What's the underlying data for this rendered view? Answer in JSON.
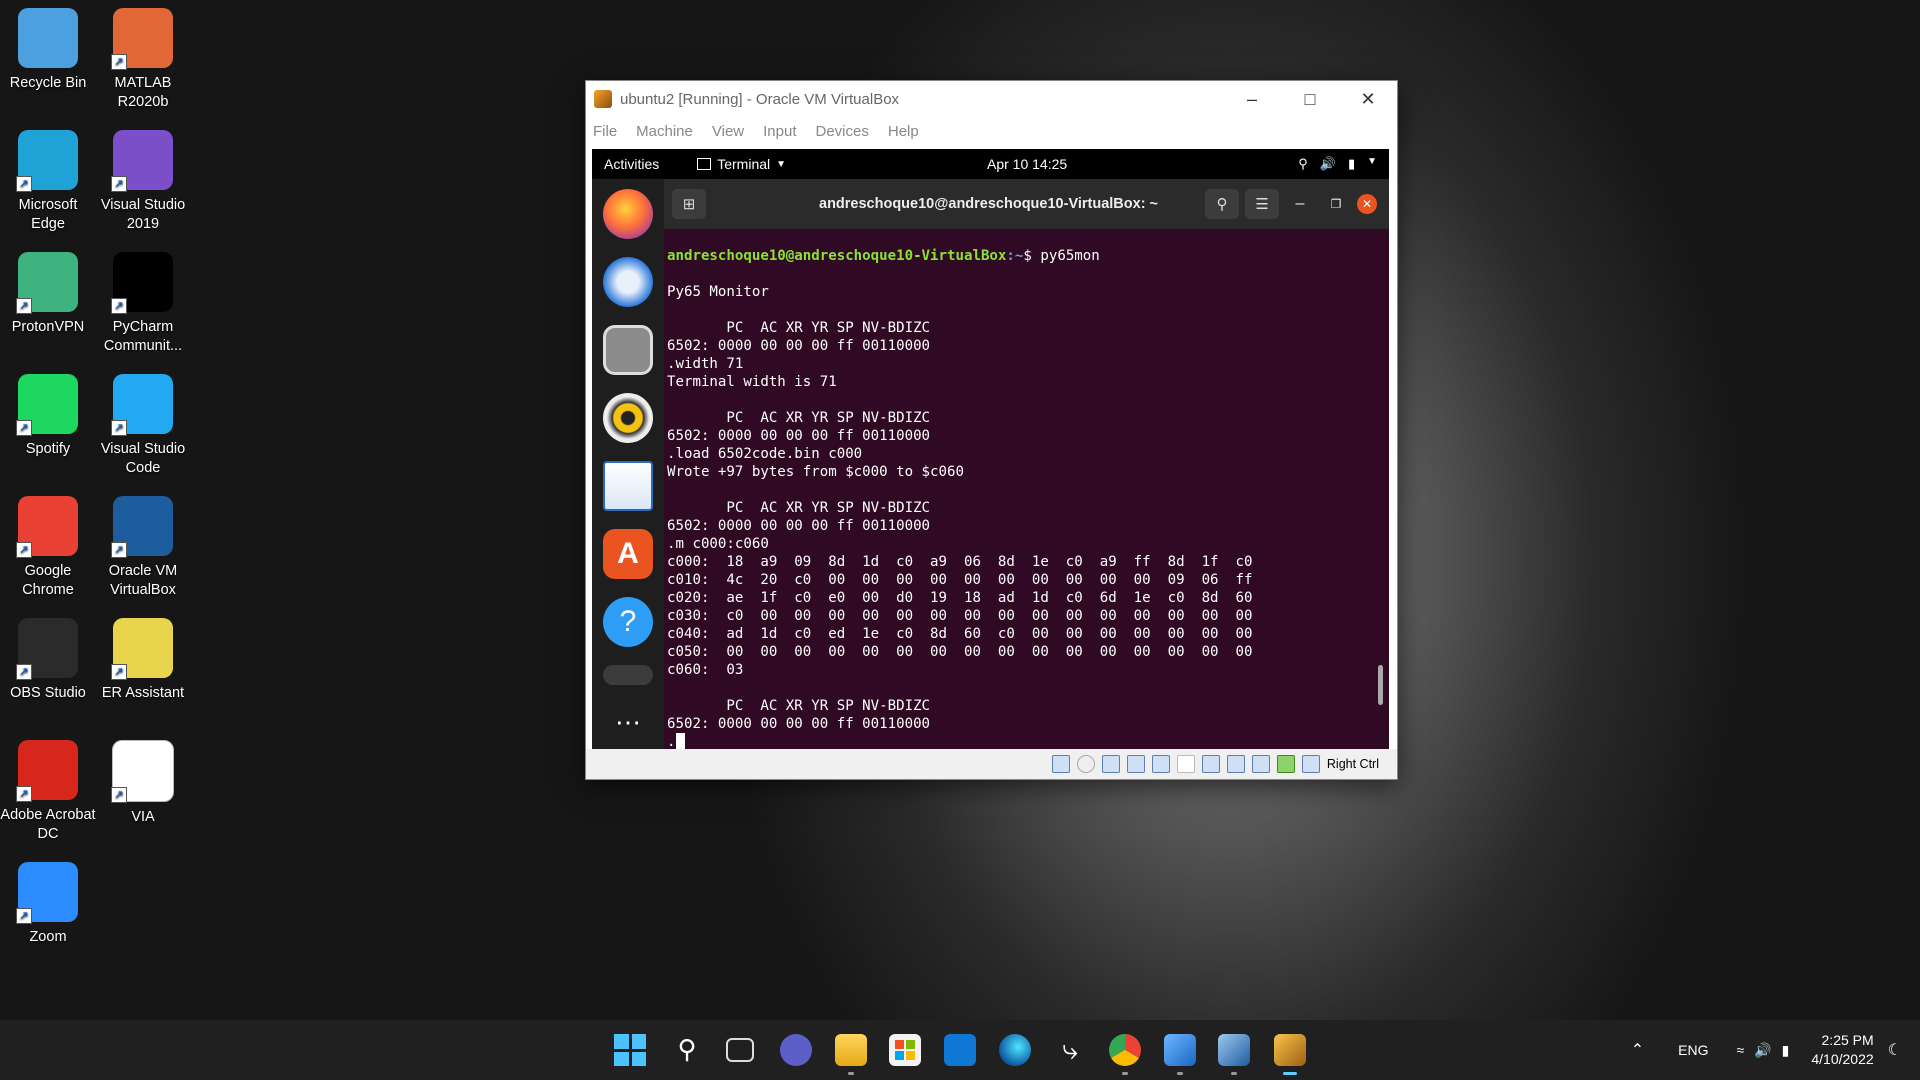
{
  "desktop": {
    "icons": [
      {
        "label": "Recycle Bin",
        "icon": "recycle-bin-icon",
        "color": "#4ca0e0"
      },
      {
        "label": "MATLAB R2020b",
        "icon": "matlab-icon",
        "color": "#e16737"
      },
      {
        "label": "Microsoft Edge",
        "icon": "edge-icon",
        "color": "#1fa3d6"
      },
      {
        "label": "Visual Studio 2019",
        "icon": "visual-studio-icon",
        "color": "#7b4fc8"
      },
      {
        "label": "ProtonVPN",
        "icon": "protonvpn-icon",
        "color": "#3fb37f"
      },
      {
        "label": "PyCharm Communit...",
        "icon": "pycharm-icon",
        "color": "#000000"
      },
      {
        "label": "Spotify",
        "icon": "spotify-icon",
        "color": "#1ed760"
      },
      {
        "label": "Visual Studio Code",
        "icon": "vscode-icon",
        "color": "#23a9f2"
      },
      {
        "label": "Google Chrome",
        "icon": "chrome-icon",
        "color": "#e94235"
      },
      {
        "label": "Oracle VM VirtualBox",
        "icon": "virtualbox-icon",
        "color": "#1d5d9e"
      },
      {
        "label": "OBS Studio",
        "icon": "obs-icon",
        "color": "#2b2b2b"
      },
      {
        "label": "ER Assistant",
        "icon": "er-assistant-icon",
        "color": "#e8d44d"
      },
      {
        "label": "Adobe Acrobat DC",
        "icon": "acrobat-icon",
        "color": "#d7261c"
      },
      {
        "label": "VIA",
        "icon": "via-icon",
        "color": "#ffffff"
      },
      {
        "label": "Zoom",
        "icon": "zoom-icon",
        "color": "#2d8cff"
      }
    ]
  },
  "vbox": {
    "title": "ubuntu2 [Running] - Oracle VM VirtualBox",
    "menu": [
      "File",
      "Machine",
      "View",
      "Input",
      "Devices",
      "Help"
    ],
    "host_key": "Right Ctrl"
  },
  "guest": {
    "activities": "Activities",
    "app_menu": "Terminal",
    "clock": "Apr 10  14:25",
    "terminal_title": "andreschoque10@andreschoque10-VirtualBox: ~",
    "prompt_user": "andreschoque10@andreschoque10-VirtualBox",
    "prompt_path": ":~",
    "prompt_cmd": "$ py65mon",
    "output": "\nPy65 Monitor\n\n       PC  AC XR YR SP NV-BDIZC\n6502: 0000 00 00 00 ff 00110000\n.width 71\nTerminal width is 71\n\n       PC  AC XR YR SP NV-BDIZC\n6502: 0000 00 00 00 ff 00110000\n.load 6502code.bin c000\nWrote +97 bytes from $c000 to $c060\n\n       PC  AC XR YR SP NV-BDIZC\n6502: 0000 00 00 00 ff 00110000\n.m c000:c060\nc000:  18  a9  09  8d  1d  c0  a9  06  8d  1e  c0  a9  ff  8d  1f  c0\nc010:  4c  20  c0  00  00  00  00  00  00  00  00  00  00  09  06  ff\nc020:  ae  1f  c0  e0  00  d0  19  18  ad  1d  c0  6d  1e  c0  8d  60\nc030:  c0  00  00  00  00  00  00  00  00  00  00  00  00  00  00  00\nc040:  ad  1d  c0  ed  1e  c0  8d  60  c0  00  00  00  00  00  00  00\nc050:  00  00  00  00  00  00  00  00  00  00  00  00  00  00  00  00\nc060:  03\n\n       PC  AC XR YR SP NV-BDIZC\n6502: 0000 00 00 00 ff 00110000\n."
  },
  "taskbar": {
    "language": "ENG",
    "time": "2:25 PM",
    "date": "4/10/2022"
  }
}
